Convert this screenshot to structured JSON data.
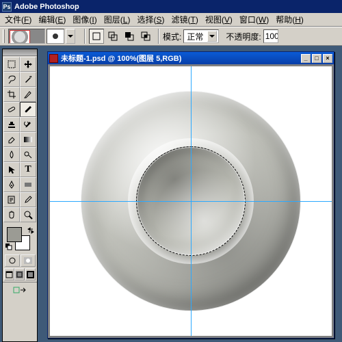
{
  "app": {
    "title": "Adobe Photoshop"
  },
  "menu": {
    "items": [
      {
        "label": "文件",
        "accel": "F"
      },
      {
        "label": "编辑",
        "accel": "E"
      },
      {
        "label": "图像",
        "accel": "I"
      },
      {
        "label": "图层",
        "accel": "L"
      },
      {
        "label": "选择",
        "accel": "S"
      },
      {
        "label": "滤镜",
        "accel": "T"
      },
      {
        "label": "视图",
        "accel": "V"
      },
      {
        "label": "窗口",
        "accel": "W"
      },
      {
        "label": "帮助",
        "accel": "H"
      }
    ]
  },
  "options": {
    "icon_group1": [
      "new-selection",
      "add-to-selection",
      "subtract-from-selection",
      "intersect-selection"
    ],
    "mode_label": "模式:",
    "mode_value": "正常",
    "opacity_label": "不透明度:",
    "opacity_value": "100"
  },
  "toolbox": {
    "rows": [
      [
        "marquee-rect",
        "move"
      ],
      [
        "lasso",
        "magic-wand"
      ],
      [
        "crop",
        "slice"
      ],
      [
        "healing-brush",
        "brush"
      ],
      [
        "clone-stamp",
        "history-brush"
      ],
      [
        "eraser",
        "gradient"
      ],
      [
        "blur",
        "dodge"
      ],
      [
        "path-select",
        "type"
      ],
      [
        "pen",
        "shape"
      ],
      [
        "notes",
        "eyedropper"
      ],
      [
        "hand",
        "zoom"
      ]
    ],
    "active_tool": "brush",
    "fg_color": "#9b9b94",
    "bg_color": "#ffffff"
  },
  "document": {
    "title": "未标题-1.psd @ 100%(图层 5,RGB)",
    "zoom": "100%",
    "layer": "图层 5",
    "mode": "RGB",
    "guides": {
      "v": 0.5,
      "h": 0.5
    },
    "selection": {
      "shape": "circle",
      "diameter_ratio": 0.4
    },
    "canvas_bg": "#ffffff"
  },
  "icons": {
    "marquee-rect": "▭",
    "move": "✥",
    "lasso": "⟆",
    "magic-wand": "✶",
    "crop": "✂",
    "slice": "⌗",
    "healing-brush": "✚",
    "brush": "🖌",
    "clone-stamp": "⌸",
    "history-brush": "↺",
    "eraser": "⬚",
    "gradient": "▤",
    "blur": "💧",
    "dodge": "◑",
    "path-select": "▶",
    "type": "T",
    "pen": "✒",
    "shape": "▬",
    "notes": "✎",
    "eyedropper": "◉",
    "hand": "✋",
    "zoom": "🔍"
  }
}
